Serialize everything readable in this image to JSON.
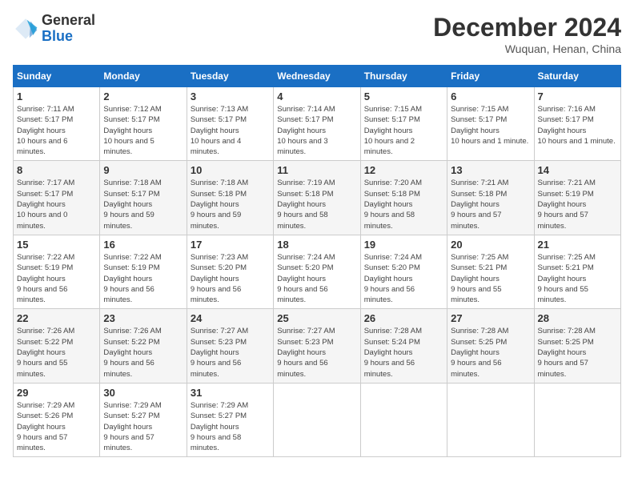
{
  "logo": {
    "line1": "General",
    "line2": "Blue"
  },
  "title": "December 2024",
  "location": "Wuquan, Henan, China",
  "days_header": [
    "Sunday",
    "Monday",
    "Tuesday",
    "Wednesday",
    "Thursday",
    "Friday",
    "Saturday"
  ],
  "weeks": [
    [
      {
        "num": "1",
        "rise": "7:11 AM",
        "set": "5:17 PM",
        "daylight": "10 hours and 6 minutes."
      },
      {
        "num": "2",
        "rise": "7:12 AM",
        "set": "5:17 PM",
        "daylight": "10 hours and 5 minutes."
      },
      {
        "num": "3",
        "rise": "7:13 AM",
        "set": "5:17 PM",
        "daylight": "10 hours and 4 minutes."
      },
      {
        "num": "4",
        "rise": "7:14 AM",
        "set": "5:17 PM",
        "daylight": "10 hours and 3 minutes."
      },
      {
        "num": "5",
        "rise": "7:15 AM",
        "set": "5:17 PM",
        "daylight": "10 hours and 2 minutes."
      },
      {
        "num": "6",
        "rise": "7:15 AM",
        "set": "5:17 PM",
        "daylight": "10 hours and 1 minute."
      },
      {
        "num": "7",
        "rise": "7:16 AM",
        "set": "5:17 PM",
        "daylight": "10 hours and 1 minute."
      }
    ],
    [
      {
        "num": "8",
        "rise": "7:17 AM",
        "set": "5:17 PM",
        "daylight": "10 hours and 0 minutes."
      },
      {
        "num": "9",
        "rise": "7:18 AM",
        "set": "5:17 PM",
        "daylight": "9 hours and 59 minutes."
      },
      {
        "num": "10",
        "rise": "7:18 AM",
        "set": "5:18 PM",
        "daylight": "9 hours and 59 minutes."
      },
      {
        "num": "11",
        "rise": "7:19 AM",
        "set": "5:18 PM",
        "daylight": "9 hours and 58 minutes."
      },
      {
        "num": "12",
        "rise": "7:20 AM",
        "set": "5:18 PM",
        "daylight": "9 hours and 58 minutes."
      },
      {
        "num": "13",
        "rise": "7:21 AM",
        "set": "5:18 PM",
        "daylight": "9 hours and 57 minutes."
      },
      {
        "num": "14",
        "rise": "7:21 AM",
        "set": "5:19 PM",
        "daylight": "9 hours and 57 minutes."
      }
    ],
    [
      {
        "num": "15",
        "rise": "7:22 AM",
        "set": "5:19 PM",
        "daylight": "9 hours and 56 minutes."
      },
      {
        "num": "16",
        "rise": "7:22 AM",
        "set": "5:19 PM",
        "daylight": "9 hours and 56 minutes."
      },
      {
        "num": "17",
        "rise": "7:23 AM",
        "set": "5:20 PM",
        "daylight": "9 hours and 56 minutes."
      },
      {
        "num": "18",
        "rise": "7:24 AM",
        "set": "5:20 PM",
        "daylight": "9 hours and 56 minutes."
      },
      {
        "num": "19",
        "rise": "7:24 AM",
        "set": "5:20 PM",
        "daylight": "9 hours and 56 minutes."
      },
      {
        "num": "20",
        "rise": "7:25 AM",
        "set": "5:21 PM",
        "daylight": "9 hours and 55 minutes."
      },
      {
        "num": "21",
        "rise": "7:25 AM",
        "set": "5:21 PM",
        "daylight": "9 hours and 55 minutes."
      }
    ],
    [
      {
        "num": "22",
        "rise": "7:26 AM",
        "set": "5:22 PM",
        "daylight": "9 hours and 55 minutes."
      },
      {
        "num": "23",
        "rise": "7:26 AM",
        "set": "5:22 PM",
        "daylight": "9 hours and 56 minutes."
      },
      {
        "num": "24",
        "rise": "7:27 AM",
        "set": "5:23 PM",
        "daylight": "9 hours and 56 minutes."
      },
      {
        "num": "25",
        "rise": "7:27 AM",
        "set": "5:23 PM",
        "daylight": "9 hours and 56 minutes."
      },
      {
        "num": "26",
        "rise": "7:28 AM",
        "set": "5:24 PM",
        "daylight": "9 hours and 56 minutes."
      },
      {
        "num": "27",
        "rise": "7:28 AM",
        "set": "5:25 PM",
        "daylight": "9 hours and 56 minutes."
      },
      {
        "num": "28",
        "rise": "7:28 AM",
        "set": "5:25 PM",
        "daylight": "9 hours and 57 minutes."
      }
    ],
    [
      {
        "num": "29",
        "rise": "7:29 AM",
        "set": "5:26 PM",
        "daylight": "9 hours and 57 minutes."
      },
      {
        "num": "30",
        "rise": "7:29 AM",
        "set": "5:27 PM",
        "daylight": "9 hours and 57 minutes."
      },
      {
        "num": "31",
        "rise": "7:29 AM",
        "set": "5:27 PM",
        "daylight": "9 hours and 58 minutes."
      },
      null,
      null,
      null,
      null
    ]
  ]
}
